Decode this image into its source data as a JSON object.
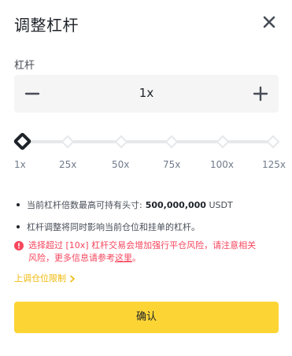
{
  "dialog": {
    "title": "调整杠杆",
    "close_icon": "close-icon"
  },
  "leverage": {
    "label": "杠杆",
    "value": "1x",
    "minus_icon": "minus-icon",
    "plus_icon": "plus-icon"
  },
  "slider": {
    "current_fraction": 0,
    "marks": [
      "1x",
      "25x",
      "50x",
      "75x",
      "100x",
      "125x"
    ]
  },
  "notes": {
    "max_position_prefix": "当前杠杆倍数最高可持有头寸:",
    "max_position_value": "500,000,000",
    "max_position_unit": "USDT",
    "affects": "杠杆调整将同时影响当前仓位和挂单的杠杆。",
    "warning_line1": "选择超过 [10x] 杠杆交易会增加强行平仓风险，请注意相关",
    "warning_line2_prefix": "风险，更多信息请参考",
    "warning_link": "这里",
    "warning_line2_suffix": "。"
  },
  "limit_link": "上调仓位限制",
  "confirm_label": "确认",
  "colors": {
    "accent": "#fcd535",
    "link": "#f0b90b",
    "warning": "#f6465d",
    "text": "#1e2329"
  }
}
